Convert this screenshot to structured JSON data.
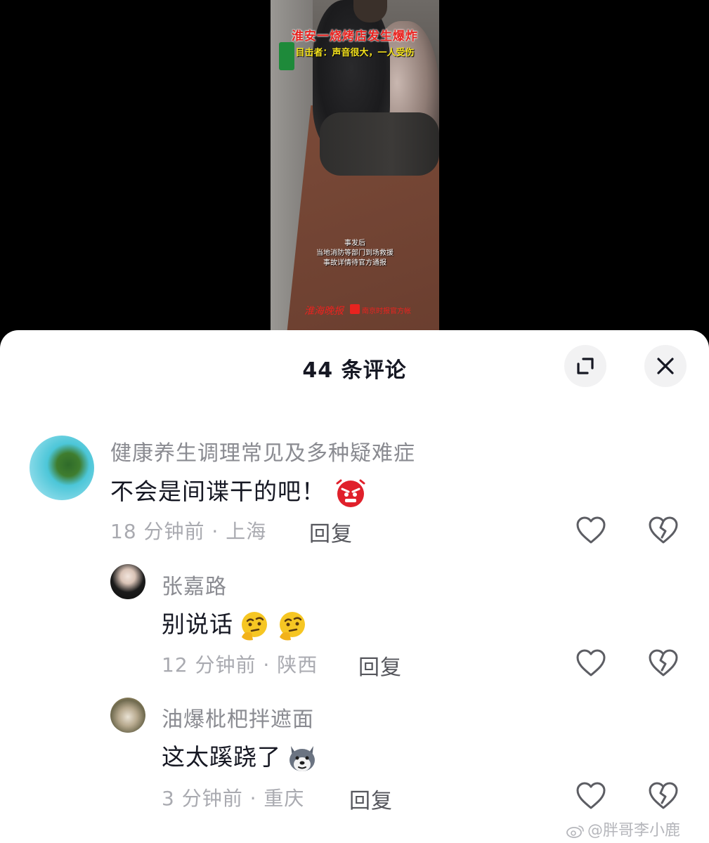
{
  "video": {
    "caption_title": "淮安一烧烤店发生爆炸",
    "caption_sub": "目击者：声音很大，一人受伤",
    "caption_bottom": [
      "事发后",
      "当地消防等部门到场救援",
      "事故详情待官方通报"
    ],
    "watermark_logo": "淮海晚报",
    "watermark_text": "南京时报官方帐"
  },
  "comments_sheet": {
    "title": "44 条评论",
    "expand_icon": "expand-icon",
    "close_icon": "close-icon"
  },
  "comments": [
    {
      "user": "健康养生调理常见及多种疑难症",
      "text": "不会是间谍干的吧！",
      "emoji": "angry-face-emoji",
      "meta": "18 分钟前 · 上海",
      "reply_label": "回复"
    },
    {
      "user": "张嘉路",
      "text": "别说话",
      "emoji": "thinking-face-emoji",
      "meta": "12 分钟前 · 陕西",
      "reply_label": "回复"
    },
    {
      "user": "油爆枇杷拌遮面",
      "text": "这太蹊跷了",
      "emoji": "husky-dog-emoji",
      "meta": "3 分钟前 · 重庆",
      "reply_label": "回复"
    }
  ],
  "watermark": "@胖哥李小鹿",
  "colors": {
    "title_text": "#161823",
    "username": "#8a8b91",
    "meta": "#a9aab0",
    "caption_red": "#e8231f",
    "caption_yellow": "#f4e21d"
  }
}
